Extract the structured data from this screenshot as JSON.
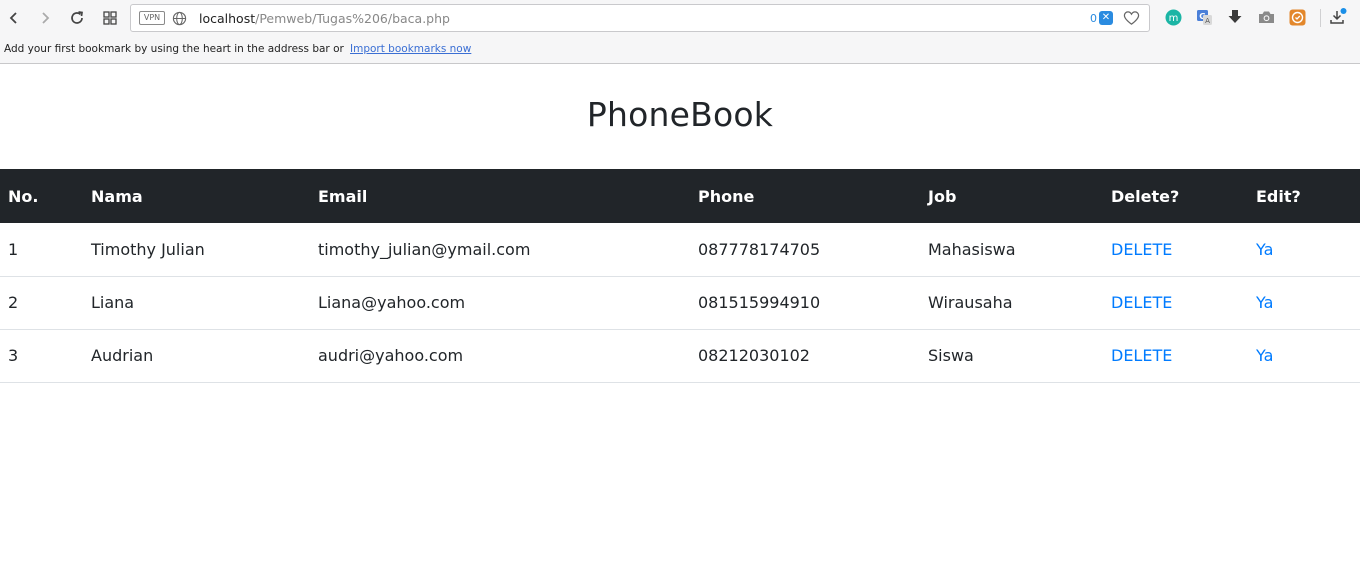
{
  "browser": {
    "url_host": "localhost",
    "url_path": "/Pemweb/Tugas%206/baca.php",
    "vpn_label": "VPN",
    "adblock_count": "0",
    "bookmark_hint": "Add your first bookmark by using the heart in the address bar or",
    "import_bookmarks_link": "Import bookmarks now",
    "accent_color": "#2a8be0"
  },
  "page": {
    "title": "PhoneBook",
    "table": {
      "headers": [
        "No.",
        "Nama",
        "Email",
        "Phone",
        "Job",
        "Delete?",
        "Edit?"
      ],
      "rows": [
        {
          "no": "1",
          "nama": "Timothy Julian",
          "email": "timothy_julian@ymail.com",
          "phone": "087778174705",
          "job": "Mahasiswa",
          "delete": "DELETE",
          "edit": "Ya"
        },
        {
          "no": "2",
          "nama": "Liana",
          "email": "Liana@yahoo.com",
          "phone": "081515994910",
          "job": "Wirausaha",
          "delete": "DELETE",
          "edit": "Ya"
        },
        {
          "no": "3",
          "nama": "Audrian",
          "email": "audri@yahoo.com",
          "phone": "08212030102",
          "job": "Siswa",
          "delete": "DELETE",
          "edit": "Ya"
        }
      ],
      "header_bg": "#212529",
      "link_color": "#007bff"
    }
  }
}
